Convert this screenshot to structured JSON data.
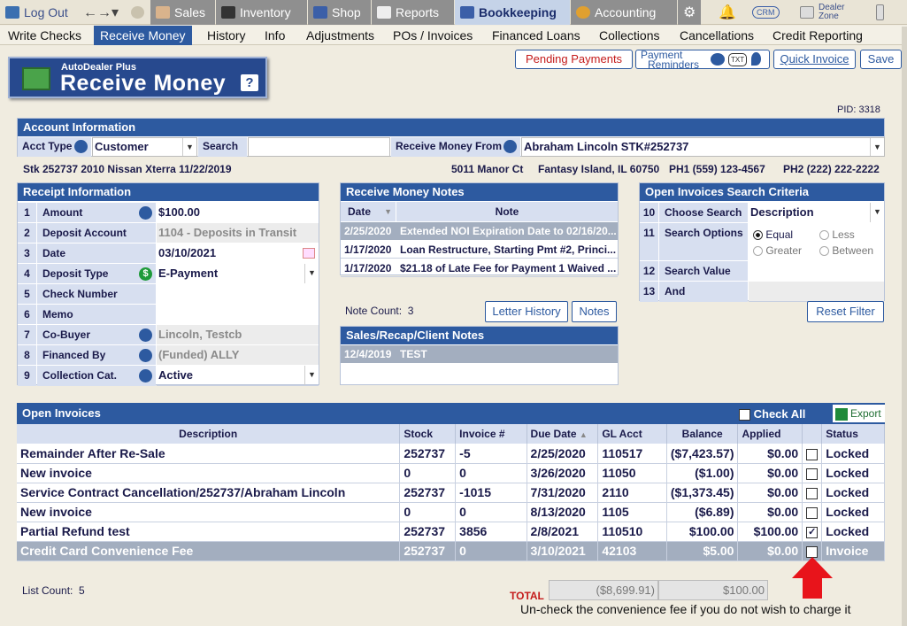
{
  "topnav": {
    "logout": "Log Out",
    "sales": "Sales",
    "inventory": "Inventory",
    "shop": "Shop",
    "reports": "Reports",
    "bookkeeping": "Bookkeeping",
    "accounting": "Accounting",
    "crm": "CRM",
    "dealer_zone_1": "Dealer",
    "dealer_zone_2": "Zone"
  },
  "subnav": [
    "Write Checks",
    "Receive Money",
    "History",
    "Info",
    "Adjustments",
    "POs / Invoices",
    "Financed Loans",
    "Collections",
    "Cancellations",
    "Credit Reporting"
  ],
  "header": {
    "badge_sub": "AutoDealer Plus",
    "badge_title": "Receive Money",
    "pending_payments": "Pending Payments",
    "payment_reminders_1": "Payment",
    "payment_reminders_2": "Reminders",
    "txt": "TXT",
    "quick_invoice": "Quick Invoice",
    "save": "Save",
    "pid": "PID: 3318"
  },
  "account": {
    "title": "Account Information",
    "acct_type_label": "Acct Type",
    "acct_type_value": "Customer",
    "search_label": "Search",
    "receive_from_label": "Receive Money From",
    "receive_from_value": "Abraham Lincoln STK#252737",
    "stk_line": "Stk 252737 2010 Nissan Xterra 11/22/2019",
    "address": "5011 Manor Ct",
    "city": "Fantasy Island, IL 60750",
    "ph1": "PH1 (559) 123-4567",
    "ph2": "PH2 (222) 222-2222"
  },
  "receipt": {
    "title": "Receipt Information",
    "rows": [
      {
        "num": "1",
        "label": "Amount",
        "value": "$100.00"
      },
      {
        "num": "2",
        "label": "Deposit Account",
        "value": "1104 - Deposits in Transit"
      },
      {
        "num": "3",
        "label": "Date",
        "value": "03/10/2021"
      },
      {
        "num": "4",
        "label": "Deposit Type",
        "value": "E-Payment"
      },
      {
        "num": "5",
        "label": "Check Number",
        "value": ""
      },
      {
        "num": "6",
        "label": "Memo",
        "value": ""
      },
      {
        "num": "7",
        "label": "Co-Buyer",
        "value": "Lincoln, Testcb"
      },
      {
        "num": "8",
        "label": "Financed By",
        "value": "(Funded) ALLY"
      },
      {
        "num": "9",
        "label": "Collection Cat.",
        "value": "Active"
      }
    ]
  },
  "notes": {
    "title": "Receive Money Notes",
    "col_date": "Date",
    "col_note": "Note",
    "rows": [
      {
        "date": "2/25/2020",
        "note": "Extended NOI Expiration Date to 02/16/20..."
      },
      {
        "date": "1/17/2020",
        "note": "Loan Restructure, Starting Pmt #2, Princi..."
      },
      {
        "date": "1/17/2020",
        "note": "$21.18 of Late Fee for Payment 1 Waived ..."
      }
    ],
    "note_count_label": "Note Count:",
    "note_count": "3",
    "letter_history": "Letter History",
    "notes_btn": "Notes",
    "recap_title": "Sales/Recap/Client Notes",
    "recap_date": "12/4/2019",
    "recap_text": "TEST"
  },
  "search": {
    "title": "Open Invoices Search Criteria",
    "choose_num": "10",
    "choose_label": "Choose Search",
    "choose_value": "Description",
    "options_num": "11",
    "options_label": "Search Options",
    "opt_equal": "Equal",
    "opt_less": "Less",
    "opt_greater": "Greater",
    "opt_between": "Between",
    "value_num": "12",
    "value_label": "Search Value",
    "and_num": "13",
    "and_label": "And",
    "reset": "Reset Filter"
  },
  "invoices": {
    "title": "Open Invoices",
    "check_all": "Check All",
    "export": "Export",
    "headers": [
      "Description",
      "Stock",
      "Invoice #",
      "Due Date",
      "GL Acct",
      "Balance",
      "Applied",
      "",
      "Status"
    ],
    "rows": [
      {
        "desc": "Remainder After Re-Sale",
        "stock": "252737",
        "inv": "-5",
        "due": "2/25/2020",
        "gl": "110517",
        "bal": "($7,423.57)",
        "applied": "$0.00",
        "checked": "",
        "status": "Locked"
      },
      {
        "desc": "New invoice",
        "stock": "0",
        "inv": "0",
        "due": "3/26/2020",
        "gl": "11050",
        "bal": "($1.00)",
        "applied": "$0.00",
        "checked": "",
        "status": "Locked"
      },
      {
        "desc": "Service Contract Cancellation/252737/Abraham Lincoln",
        "stock": "252737",
        "inv": "-1015",
        "due": "7/31/2020",
        "gl": "2110",
        "bal": "($1,373.45)",
        "applied": "$0.00",
        "checked": "",
        "status": "Locked"
      },
      {
        "desc": "New invoice",
        "stock": "0",
        "inv": "0",
        "due": "8/13/2020",
        "gl": "1105",
        "bal": "($6.89)",
        "applied": "$0.00",
        "checked": "",
        "status": "Locked"
      },
      {
        "desc": "Partial Refund test",
        "stock": "252737",
        "inv": "3856",
        "due": "2/8/2021",
        "gl": "110510",
        "bal": "$100.00",
        "applied": "$100.00",
        "checked": "✓",
        "status": "Locked"
      },
      {
        "desc": "Credit Card Convenience Fee",
        "stock": "252737",
        "inv": "0",
        "due": "3/10/2021",
        "gl": "42103",
        "bal": "$5.00",
        "applied": "$0.00",
        "checked": "",
        "status": "Invoice"
      }
    ],
    "list_count_label": "List Count:",
    "list_count": "5",
    "total_label": "TOTAL",
    "total_balance": "($8,699.91)",
    "total_applied": "$100.00",
    "annotation": "Un-check the convenience fee if you do not wish to charge it"
  },
  "colors": {
    "accent": "#2d5aa0",
    "header_bg": "#27498e",
    "arrow": "#e8141b"
  }
}
